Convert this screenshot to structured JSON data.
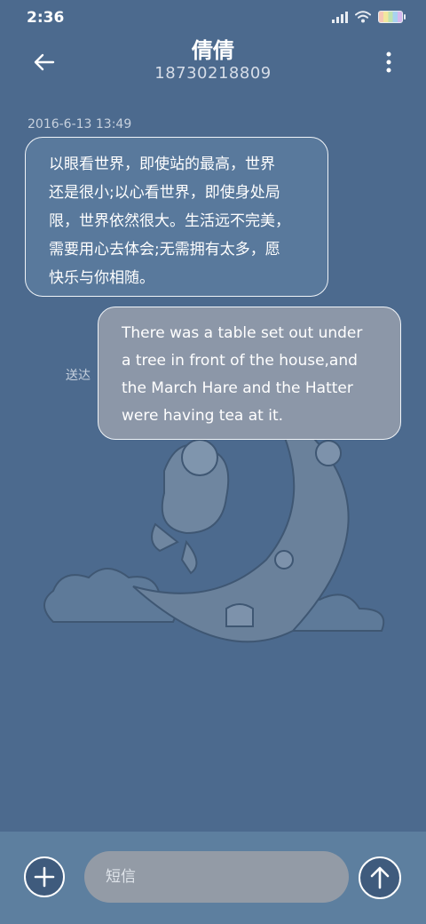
{
  "status_bar": {
    "time": "2:36",
    "icons": [
      "signal-icon",
      "wifi-icon",
      "battery-icon"
    ]
  },
  "header": {
    "contact_name": "倩倩",
    "phone_number": "18730218809",
    "back_icon": "back-arrow-icon",
    "menu_icon": "more-vertical-icon"
  },
  "conversation": {
    "timestamp": "2016-6-13 13:49",
    "messages": [
      {
        "direction": "incoming",
        "lines": [
          "以眼看世界，即使站的最高，世界",
          "还是很小;以心看世界，即使身处局",
          "限，世界依然很大。生活远不完美，",
          "需要用心去体会;无需拥有太多，愿",
          "快乐与你相随。"
        ]
      },
      {
        "direction": "outgoing",
        "lines": [
          "There was a table set out under",
          "a tree in front of the house,and",
          "the March Hare and the Hatter",
          "were having tea at it."
        ],
        "status": "送达"
      }
    ]
  },
  "composer": {
    "placeholder": "短信",
    "value": "",
    "add_icon": "plus-icon",
    "send_icon": "send-arrow-icon"
  },
  "colors": {
    "background": "#4c6a8e",
    "incoming_bubble": "#59799c",
    "outgoing_bubble": "#8c97a8",
    "bottom_bar": "#5d7f9f"
  }
}
